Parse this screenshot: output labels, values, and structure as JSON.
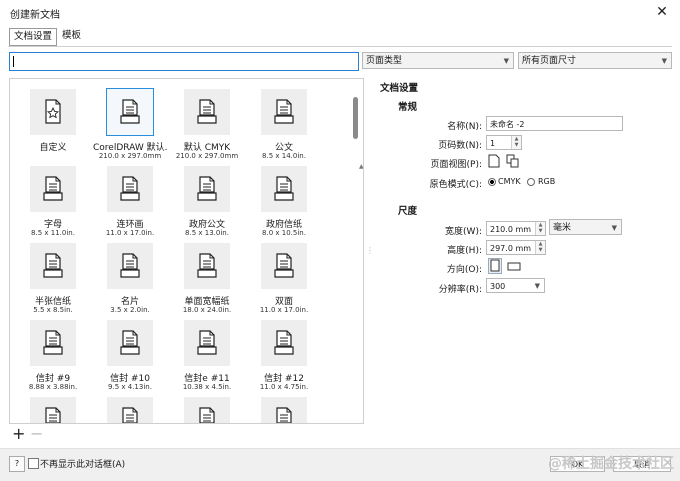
{
  "window": {
    "title": "创建新文档",
    "close": "✕"
  },
  "tabs": [
    {
      "label": "文档设置"
    },
    {
      "label": "模板"
    }
  ],
  "search": {
    "value": ""
  },
  "filters": {
    "type": "页面类型",
    "size": "所有页面尺寸"
  },
  "templates": [
    {
      "name": "自定义",
      "size": "",
      "icon": "star-page-icon"
    },
    {
      "name": "CorelDRAW 默认...",
      "size": "210.0 x 297.0mm",
      "icon": "page-icon"
    },
    {
      "name": "默认 CMYK",
      "size": "210.0 x 297.0mm",
      "icon": "page-icon"
    },
    {
      "name": "公文",
      "size": "8.5 x 14.0in.",
      "icon": "page-icon"
    },
    {
      "name": "字母",
      "size": "8.5 x 11.0in.",
      "icon": "page-icon"
    },
    {
      "name": "连环画",
      "size": "11.0 x 17.0in.",
      "icon": "page-icon"
    },
    {
      "name": "政府公文",
      "size": "8.5 x 13.0in.",
      "icon": "page-icon"
    },
    {
      "name": "政府信纸",
      "size": "8.0 x 10.5in.",
      "icon": "page-icon"
    },
    {
      "name": "半张信纸",
      "size": "5.5 x 8.5in.",
      "icon": "page-icon"
    },
    {
      "name": "名片",
      "size": "3.5 x 2.0in.",
      "icon": "page-icon"
    },
    {
      "name": "单面宽幅纸",
      "size": "18.0 x 24.0in.",
      "icon": "page-icon"
    },
    {
      "name": "双面",
      "size": "11.0 x 17.0in.",
      "icon": "page-icon"
    },
    {
      "name": "信封 #9",
      "size": "8.88 x 3.88in.",
      "icon": "page-icon"
    },
    {
      "name": "信封 #10",
      "size": "9.5 x 4.13in.",
      "icon": "page-icon"
    },
    {
      "name": "信封e #11",
      "size": "10.38 x 4.5in.",
      "icon": "page-icon"
    },
    {
      "name": "信封 #12",
      "size": "11.0 x 4.75in.",
      "icon": "page-icon"
    }
  ],
  "settings": {
    "title": "文档设置",
    "general": {
      "header": "常规",
      "name_label": "名称(N):",
      "name_value": "未命名 -2",
      "pages_label": "页码数(N):",
      "pages_value": "1",
      "view_label": "页面视图(P):",
      "color_label": "原色模式(C):",
      "color_options": [
        "CMYK",
        "RGB"
      ],
      "color_selected": "CMYK"
    },
    "dimensions": {
      "header": "尺度",
      "width_label": "宽度(W):",
      "width_value": "210.0 mm",
      "unit_value": "毫米",
      "height_label": "高度(H):",
      "height_value": "297.0 mm",
      "orientation_label": "方向(O):",
      "resolution_label": "分辨率(R):",
      "resolution_value": "300"
    }
  },
  "footer": {
    "help": "?",
    "dont_show": "不再显示此对话框(A)",
    "ok": "OK",
    "cancel": "取消"
  },
  "watermark": "@稀土掘金技术社区"
}
